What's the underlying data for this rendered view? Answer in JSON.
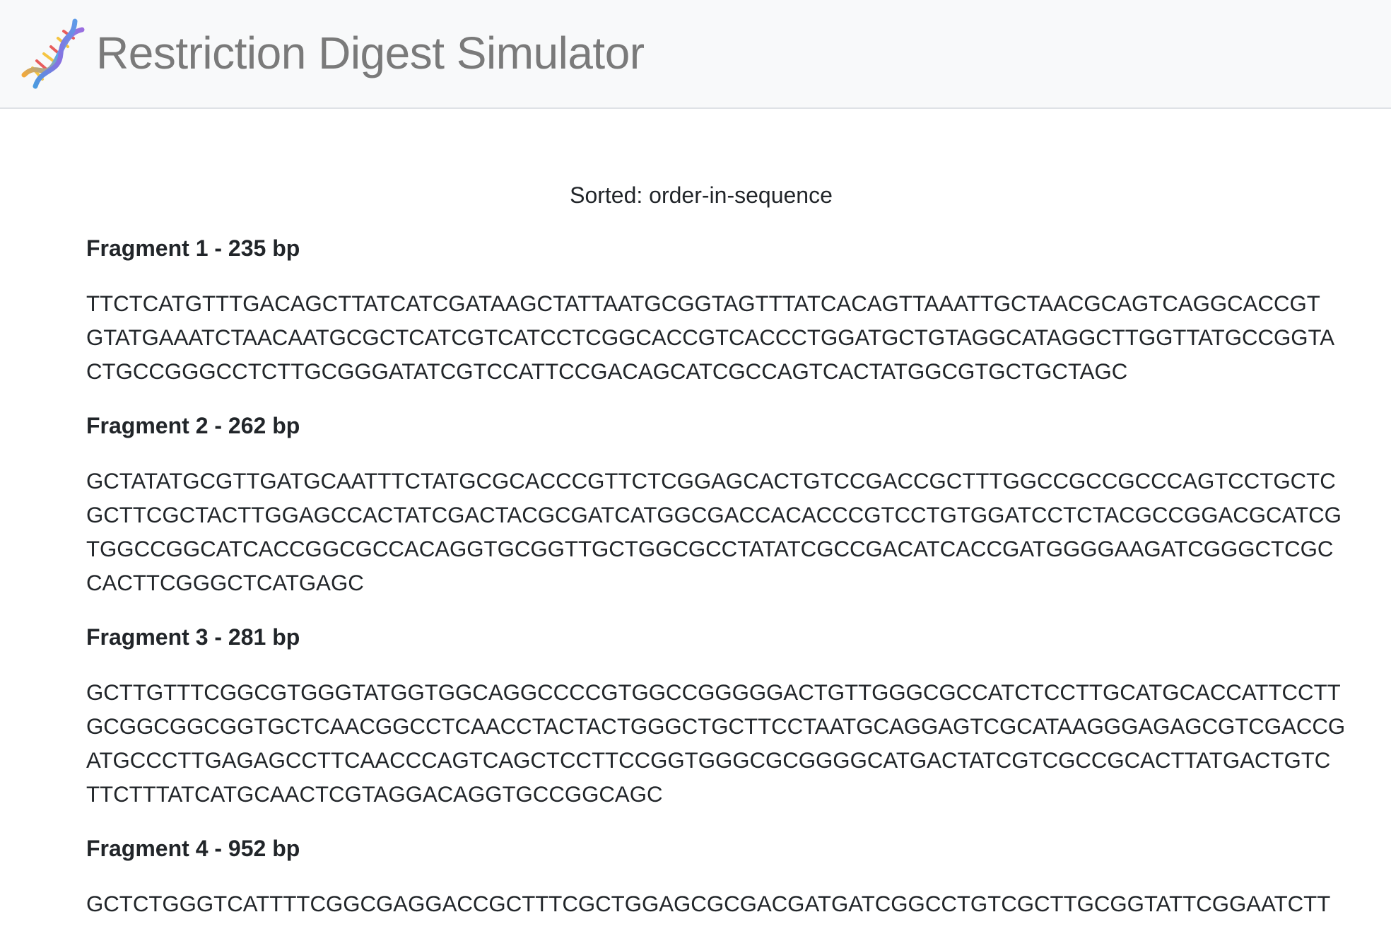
{
  "header": {
    "title": "Restriction Digest Simulator",
    "logo_icon": "dna-helix-icon"
  },
  "sort": {
    "label": "Sorted: order-in-sequence"
  },
  "fragments": [
    {
      "title": "Fragment 1 - 235 bp",
      "lines": [
        "TTCTCATGTTTGACAGCTTATCATCGATAAGCTATTAATGCGGTAGTTTATCACAGTTAAATTGCTAACGCAGTCAGGCACCGT",
        "GTATGAAATCTAACAATGCGCTCATCGTCATCCTCGGCACCGTCACCCTGGATGCTGTAGGCATAGGCTTGGTTATGCCGGTA",
        "CTGCCGGGCCTCTTGCGGGATATCGTCCATTCCGACAGCATCGCCAGTCACTATGGCGTGCTGCTAGC"
      ]
    },
    {
      "title": "Fragment 2 - 262 bp",
      "lines": [
        "GCTATATGCGTTGATGCAATTTCTATGCGCACCCGTTCTCGGAGCACTGTCCGACCGCTTTGGCCGCCGCCCAGTCCTGCTC",
        "GCTTCGCTACTTGGAGCCACTATCGACTACGCGATCATGGCGACCACACCCGTCCTGTGGATCCTCTACGCCGGACGCATCG",
        "TGGCCGGCATCACCGGCGCCACAGGTGCGGTTGCTGGCGCCTATATCGCCGACATCACCGATGGGGAAGATCGGGCTCGC",
        "CACTTCGGGCTCATGAGC"
      ]
    },
    {
      "title": "Fragment 3 - 281 bp",
      "lines": [
        "GCTTGTTTCGGCGTGGGTATGGTGGCAGGCCCCGTGGCCGGGGGACTGTTGGGCGCCATCTCCTTGCATGCACCATTCCTT",
        "GCGGCGGCGGTGCTCAACGGCCTCAACCTACTACTGGGCTGCTTCCTAATGCAGGAGTCGCATAAGGGAGAGCGTCGACCG",
        "ATGCCCTTGAGAGCCTTCAACCCAGTCAGCTCCTTCCGGTGGGCGCGGGGCATGACTATCGTCGCCGCACTTATGACTGTC",
        "TTCTTTATCATGCAACTCGTAGGACAGGTGCCGGCAGC"
      ]
    },
    {
      "title": "Fragment 4 - 952 bp",
      "lines": [
        "GCTCTGGGTCATTTTCGGCGAGGACCGCTTTCGCTGGAGCGCGACGATGATCGGCCTGTCGCTTGCGGTATTCGGAATCTT"
      ]
    }
  ]
}
